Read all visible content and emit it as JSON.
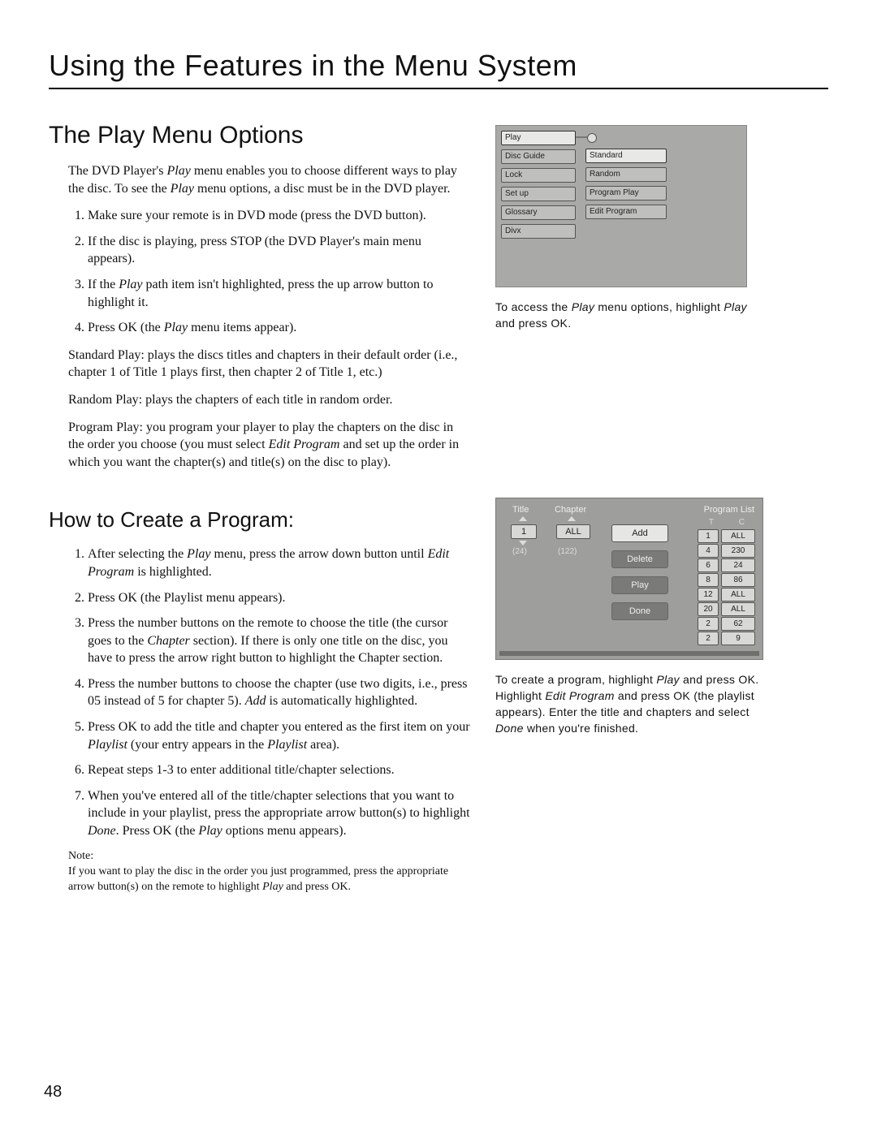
{
  "chapter_title": "Using the Features in the Menu System",
  "section1_title": "The Play Menu Options",
  "intro_a": "The DVD Player's ",
  "intro_b": " menu enables you to choose different ways to play the disc. To see the ",
  "intro_c": " menu options, a disc must be in the DVD player.",
  "play_word": "Play",
  "steps1": {
    "s1": "Make sure your remote is in DVD mode (press the DVD button).",
    "s2": "If the disc is playing, press STOP (the DVD Player's main menu appears).",
    "s3a": "If the ",
    "s3b": " path item isn't highlighted, press the up arrow button to highlight it.",
    "s4a": "Press OK (the ",
    "s4b": " menu items appear)."
  },
  "standard_a": "Standard Play:",
  "standard_b": " plays the discs titles and chapters in their default order (i.e., chapter 1 of Title 1 plays first, then chapter 2 of Title 1, etc.)",
  "random_a": "Random Play:",
  "random_b": " plays the chapters of each title in random order.",
  "program_a": "Program Play: ",
  "program_b": " you program your player to play the chapters on the disc in the order you choose (you must select ",
  "program_c": " and set up the order in which you want the chapter(s) and title(s) on the disc to play).",
  "edit_program": "Edit Program",
  "section2_title": "How to Create a Program:",
  "steps2": {
    "s1a": "After selecting the ",
    "s1b": " menu, press the arrow down button until ",
    "s1c": " is highlighted.",
    "s2": "Press OK (the Playlist menu appears).",
    "s3a": " Press the number buttons on the remote to choose the title (the cursor goes to the ",
    "s3b": " section). If there is only one title on the disc, you have to press the arrow right button to highlight the Chapter section.",
    "s4a": "Press the number buttons to choose the chapter (use two digits, i.e., press 05 instead of 5 for chapter 5). ",
    "s4b": " is automatically highlighted.",
    "s5a": "Press OK to add the title and chapter you entered as the first item on your ",
    "s5b": " (your entry appears in the ",
    "s5c": " area).",
    "s6": "Repeat steps 1-3 to enter additional title/chapter selections.",
    "s7a": "When you've entered all of the title/chapter selections that you want to include in your playlist, press the appropriate arrow button(s) to highlight ",
    "s7b": ". Press OK (the ",
    "s7c": " options menu appears)."
  },
  "chapter_word": "Chapter",
  "add_word": "Add",
  "playlist_word": "Playlist",
  "done_word": "Done",
  "note_label": "Note:",
  "note_a": "If you want to play the disc in the order you just programmed, press the appropriate arrow button(s) on the remote to highlight ",
  "note_b": " and press OK.",
  "page_number": "48",
  "fig1": {
    "left_items": [
      "Play",
      "Disc Guide",
      "Lock",
      "Set up",
      "Glossary",
      "Divx"
    ],
    "right_items": [
      "Standard",
      "Random",
      "Program Play",
      "Edit Program"
    ]
  },
  "fig1_caption_a": "To access the ",
  "fig1_caption_b": " menu options, highlight ",
  "fig1_caption_c": " and press OK.",
  "fig2": {
    "title_head": "Title",
    "chapter_head": "Chapter",
    "title_val": "1",
    "title_count": "(24)",
    "chapter_val": "ALL",
    "chapter_count": "(122)",
    "buttons": [
      "Add",
      "Delete",
      "Play",
      "Done"
    ],
    "pl_head": "Program List",
    "pl_th_t": "T",
    "pl_th_c": "C",
    "rows": [
      {
        "t": "1",
        "c": "ALL"
      },
      {
        "t": "4",
        "c": "230"
      },
      {
        "t": "6",
        "c": "24"
      },
      {
        "t": "8",
        "c": "86"
      },
      {
        "t": "12",
        "c": "ALL"
      },
      {
        "t": "20",
        "c": "ALL"
      },
      {
        "t": "2",
        "c": "62"
      },
      {
        "t": "2",
        "c": "9"
      }
    ]
  },
  "fig2_caption_a": "To create a program, highlight ",
  "fig2_caption_b": " and press OK. Highlight ",
  "fig2_caption_c": " and press OK (the playlist appears). Enter the title and chapters and select ",
  "fig2_caption_d": " when you're finished."
}
